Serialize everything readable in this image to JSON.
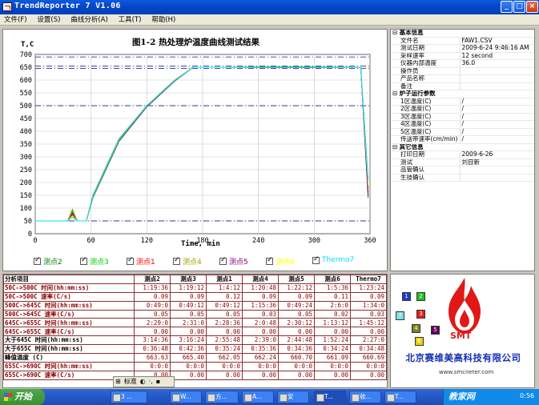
{
  "window": {
    "title": "TrendReporter 7 V1.06",
    "buttons": [
      "_",
      "□",
      "×"
    ]
  },
  "menu": [
    "文件(F)",
    "设置(S)",
    "曲线分析(A)",
    "工具(T)",
    "帮助(H)"
  ],
  "chart_data": {
    "type": "line",
    "title": "图1-2 热处理炉温度曲线测试结果",
    "ylabel": "T,C",
    "xlabel": "Time, min",
    "xlim": [
      0,
      360
    ],
    "ylim": [
      0,
      700
    ],
    "xticks": [
      0,
      60,
      120,
      180,
      240,
      300,
      360
    ],
    "yticks": [
      0,
      50,
      100,
      150,
      200,
      250,
      300,
      350,
      400,
      450,
      500,
      550,
      600,
      650,
      700
    ],
    "grid": true,
    "reference_lines": [
      50,
      500,
      645,
      655,
      690
    ],
    "series": [
      {
        "name": "测点2",
        "color": "#008000",
        "x": [
          0,
          35,
          40,
          45,
          55,
          62,
          90,
          120,
          150,
          170,
          200,
          250,
          300,
          350,
          358
        ],
        "y": [
          50,
          50,
          85,
          50,
          50,
          150,
          370,
          500,
          600,
          650,
          650,
          650,
          650,
          650,
          140
        ]
      },
      {
        "name": "测点3",
        "color": "#00c800",
        "x": [
          0,
          35,
          40,
          45,
          55,
          62,
          90,
          120,
          150,
          170,
          200,
          250,
          300,
          350,
          358
        ],
        "y": [
          50,
          50,
          95,
          50,
          50,
          140,
          360,
          495,
          596,
          650,
          650,
          652,
          652,
          650,
          200
        ]
      },
      {
        "name": "测点1",
        "color": "#ff0000",
        "x": [
          0,
          35,
          40,
          45,
          55,
          62,
          90,
          120,
          150,
          170,
          200,
          250,
          300,
          350,
          358
        ],
        "y": [
          50,
          50,
          80,
          50,
          50,
          145,
          365,
          498,
          598,
          650,
          650,
          650,
          650,
          650,
          160
        ]
      },
      {
        "name": "测点4",
        "color": "#a0a000",
        "x": [
          0,
          35,
          40,
          45,
          55,
          62,
          90,
          120,
          150,
          170,
          200,
          250,
          300,
          350,
          358
        ],
        "y": [
          50,
          50,
          90,
          50,
          50,
          148,
          368,
          500,
          600,
          650,
          650,
          651,
          651,
          650,
          180
        ]
      },
      {
        "name": "测点5",
        "color": "#800080",
        "x": [
          0,
          35,
          40,
          45,
          55,
          62,
          90,
          120,
          150,
          170,
          200,
          250,
          300,
          350,
          358
        ],
        "y": [
          50,
          50,
          75,
          50,
          50,
          142,
          362,
          496,
          597,
          650,
          650,
          649,
          649,
          650,
          150
        ]
      },
      {
        "name": "测点6",
        "color": "#ffff00",
        "x": [
          0,
          35,
          40,
          45,
          55,
          62,
          90,
          120,
          150,
          170,
          200,
          250,
          300,
          350,
          358
        ],
        "y": [
          50,
          50,
          70,
          50,
          50,
          146,
          366,
          499,
          599,
          650,
          650,
          650,
          650,
          650,
          190
        ]
      },
      {
        "name": "Thermo7",
        "color": "#00e0ff",
        "x": [
          0,
          35,
          40,
          45,
          55,
          62,
          90,
          120,
          150,
          170,
          200,
          250,
          300,
          350,
          358
        ],
        "y": [
          50,
          50,
          65,
          50,
          50,
          147,
          367,
          500,
          600,
          650,
          650,
          650,
          650,
          650,
          210
        ]
      }
    ]
  },
  "info": {
    "sections": [
      {
        "title": "基本信息",
        "rows": [
          [
            "文件名",
            "FAW1.CSV"
          ],
          [
            "测试日期",
            "2009-6-24 9:46:16 AM"
          ],
          [
            "采样速率",
            "12 second"
          ],
          [
            "仪器内部温度",
            "36.0"
          ],
          [
            "操作员",
            ""
          ],
          [
            "产品名称",
            ""
          ],
          [
            "备注",
            ""
          ]
        ]
      },
      {
        "title": "炉子运行参数",
        "rows": [
          [
            "1区温度(C)",
            "/"
          ],
          [
            "2区温度(C)",
            "/"
          ],
          [
            "3区温度(C)",
            "/"
          ],
          [
            "4区温度(C)",
            "/"
          ],
          [
            "5区温度(C)",
            "/"
          ],
          [
            "传送带速率(cm/min)",
            "/"
          ]
        ]
      },
      {
        "title": "其它信息",
        "rows": [
          [
            "打印日期",
            "2009-6-26"
          ],
          [
            "测试",
            "刘目新"
          ],
          [
            "品管确认",
            ""
          ],
          [
            "生技确认",
            ""
          ]
        ]
      }
    ]
  },
  "table": {
    "headers": [
      "分析项目",
      "测点2",
      "测点3",
      "测点1",
      "测点4",
      "测点5",
      "测点6",
      "Thermo7"
    ],
    "rows": [
      [
        "50C->500C 时间(hh:mm:ss)",
        "1:19:36",
        "1:19:12",
        "1:4:12",
        "1:20:48",
        "1:22:12",
        "1:5:36",
        "1:23:24"
      ],
      [
        "50C->500C 速率(C/s)",
        "0.09",
        "0.09",
        "0.12",
        "0.09",
        "0.09",
        "0.11",
        "0.09"
      ],
      [
        "500C->645C 时间(hh:mm:ss)",
        "0:49:0",
        "0:49:12",
        "0:49:12",
        "1:15:36",
        "0:49:24",
        "2:6:0",
        "1:34:0"
      ],
      [
        "500C->645C 速率(C/s)",
        "0.05",
        "0.05",
        "0.05",
        "0.03",
        "0.05",
        "0.02",
        "0.03"
      ],
      [
        "645C->655C 时间(hh:mm:ss)",
        "2:29:0",
        "2:31:0",
        "2:28:36",
        "2:0:48",
        "2:30:12",
        "1:13:12",
        "1:45:12"
      ],
      [
        "645C->655C 速率(C/s)",
        "0.00",
        "0.00",
        "0.00",
        "0.00",
        "0.00",
        "0.00",
        "0.00"
      ],
      [
        "大于645C 时间(hh:mm:ss)",
        "3:14:36",
        "3:16:24",
        "2:55:48",
        "2:39:0",
        "2:44:48",
        "1:52:24",
        "2:27:0"
      ],
      [
        "大于655C 时间(hh:mm:ss)",
        "0:36:48",
        "0:42:36",
        "0:35:24",
        "0:35:36",
        "0:34:36",
        "0:34:24",
        "0:34:48"
      ],
      [
        "峰值温度 (C)",
        "663.63",
        "665.40",
        "662.05",
        "662.24",
        "660.70",
        "661.09",
        "660.69"
      ],
      [
        "655C->690C 时间(hh:mm:ss)",
        "0:0:0",
        "0:0:0",
        "0:0:0",
        "0:0:0",
        "0:0:0",
        "0:0:0",
        "0:0:0"
      ],
      [
        "655C->690C 速率(C/s)",
        "0.00",
        "0.00",
        "0.00",
        "0.00",
        "0.00",
        "0.00",
        "0.00"
      ]
    ]
  },
  "logo": {
    "squares": [
      "1",
      "2",
      "3",
      "4",
      "5",
      "6",
      "7"
    ],
    "brand": "SMT",
    "company": "北京赛维美高科技有限公司",
    "url": "www.smcneter.com"
  },
  "ime": {
    "label": "标准"
  },
  "taskbar": {
    "start": "开始",
    "items": [
      "3 ...",
      "W...",
      "方...",
      "A...",
      "安",
      "T...",
      "收...",
      "T..."
    ],
    "watermark": "教家网",
    "clock": "0:56"
  }
}
